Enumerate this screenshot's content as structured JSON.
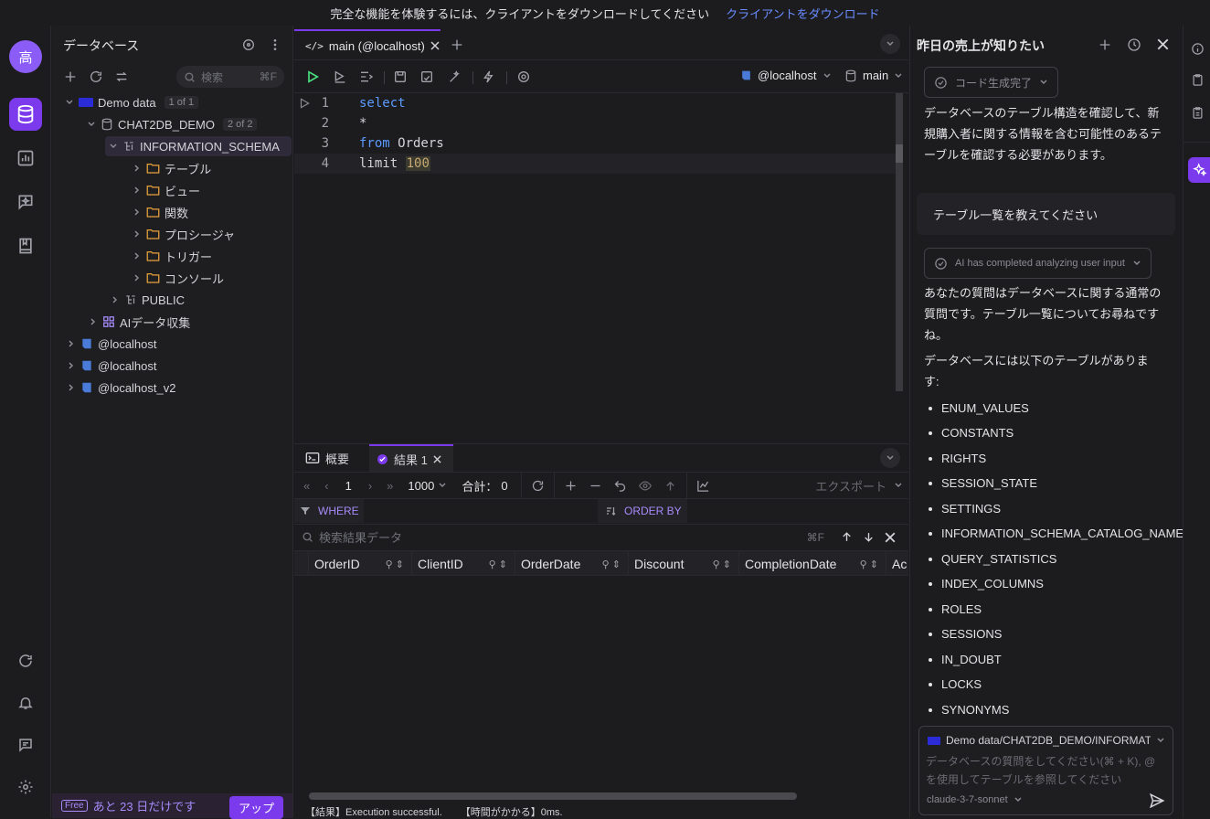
{
  "banner": {
    "text": "完全な機能を体験するには、クライアントをダウンロードしてください",
    "link": "クライアントをダウンロード"
  },
  "rail": {
    "avatar": "高"
  },
  "sidebar": {
    "title": "データベース",
    "search_placeholder": "検索",
    "search_shortcut": "⌘F",
    "tree": {
      "demo": {
        "label": "Demo data",
        "count": "1 of 1"
      },
      "chat2db": {
        "label": "CHAT2DB_DEMO",
        "count": "2 of 2"
      },
      "info_schema": "INFORMATION_SCHEMA",
      "folders": [
        "テーブル",
        "ビュー",
        "関数",
        "プロシージャ",
        "トリガー",
        "コンソール"
      ],
      "public": "PUBLIC",
      "ai_collect": "AIデータ収集",
      "conn1": "@localhost",
      "conn2": "@localhost",
      "conn3": "@localhost_v2"
    },
    "footer": {
      "free": "Free",
      "days": "あと 23 日だけです",
      "upgrade": "アップ"
    }
  },
  "editor": {
    "tab": "main (@localhost)",
    "connection": "@localhost",
    "database": "main",
    "lines": [
      {
        "n": "1",
        "parts": [
          {
            "t": "select",
            "c": "kw"
          }
        ]
      },
      {
        "n": "2",
        "parts": [
          {
            "t": "*",
            "c": ""
          }
        ]
      },
      {
        "n": "3",
        "parts": [
          {
            "t": "from",
            "c": "kw"
          },
          {
            "t": " Orders",
            "c": ""
          }
        ]
      },
      {
        "n": "4",
        "parts": [
          {
            "t": "limit",
            "c": ""
          },
          {
            "t": " ",
            "c": ""
          },
          {
            "t": "100",
            "c": "num"
          }
        ]
      }
    ]
  },
  "results": {
    "tab_overview": "概要",
    "tab_result": "結果 1",
    "page": "1",
    "page_size": "1000",
    "total_label": "合計：",
    "total": "0",
    "export": "エクスポート",
    "where": "WHERE",
    "order_by": "ORDER BY",
    "search_placeholder": "検索結果データ",
    "search_shortcut": "⌘F",
    "columns": [
      "OrderID",
      "ClientID",
      "OrderDate",
      "Discount",
      "CompletionDate",
      "Ac"
    ],
    "status_result": "【結果】Execution successful.",
    "status_time": "【時間がかかる】0ms."
  },
  "chat": {
    "title": "昨日の売上が知りたい",
    "pill1": "コード生成完了",
    "msg1": "データベースのテーブル構造を確認して、新規購入者に関する情報を含む可能性のあるテーブルを確認する必要があります。",
    "user_msg": "テーブル一覧を教えてください",
    "pill2": "AI has completed analyzing user input",
    "msg2": "あなたの質問はデータベースに関する通常の質問です。テーブル一覧についてお尋ねですね。",
    "msg3": "データベースには以下のテーブルがあります:",
    "tables": [
      "ENUM_VALUES",
      "CONSTANTS",
      "RIGHTS",
      "SESSION_STATE",
      "SETTINGS",
      "INFORMATION_SCHEMA_CATALOG_NAME",
      "QUERY_STATISTICS",
      "INDEX_COLUMNS",
      "ROLES",
      "SESSIONS",
      "IN_DOUBT",
      "LOCKS",
      "SYNONYMS"
    ],
    "context": "Demo data/CHAT2DB_DEMO/INFORMAT...",
    "input_placeholder": "データベースの質問をしてください(⌘ + K), @ を使用してテーブルを参照してください",
    "model": "claude-3-7-sonnet"
  },
  "colors": {
    "accent": "#7c3aed",
    "link": "#6a8cff",
    "keyword": "#5b9bff"
  }
}
